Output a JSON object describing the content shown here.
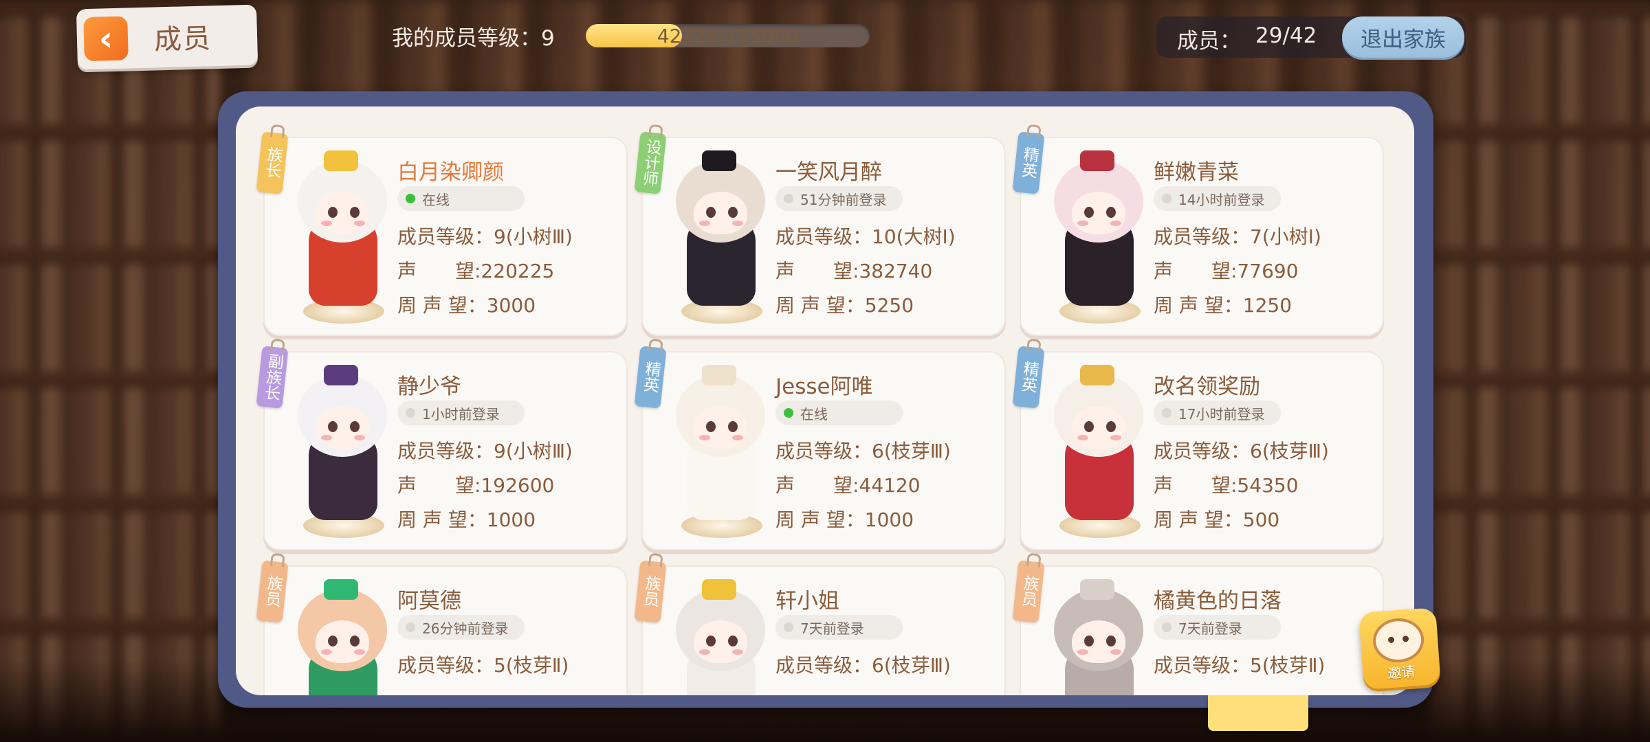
{
  "header": {
    "back_title": "成员",
    "my_level_text": "我的成员等级：9",
    "exp_text": "42225/125000",
    "exp_fraction": 0.338,
    "member_label": "成员：",
    "member_count": "29/42",
    "leave_button": "退出家族"
  },
  "members": [
    {
      "tag": "族长",
      "tag_color": "#f4c35a",
      "name": "白月染卿颜",
      "name_color": "#e6783a",
      "status": "在线",
      "online": true,
      "level": "成员等级：9(小树Ⅲ)",
      "prestige": "声　　望:220225",
      "weekly": "周 声 望：3000",
      "hair": "#f4f1ee",
      "outfit": "#d8402e",
      "accent": "#f2c23c"
    },
    {
      "tag": "设计师",
      "tag_color": "#8ccf74",
      "name": "一笑风月醉",
      "name_color": "#8a5c3c",
      "status": "51分钟前登录",
      "online": false,
      "level": "成员等级：10(大树Ⅰ)",
      "prestige": "声　　望:382740",
      "weekly": "周 声 望：5250",
      "hair": "#e9ddd2",
      "outfit": "#2b2530",
      "accent": "#1e1a1f"
    },
    {
      "tag": "精英",
      "tag_color": "#7fb0d9",
      "name": "鲜嫩青菜",
      "name_color": "#8a5c3c",
      "status": "14小时前登录",
      "online": false,
      "level": "成员等级：7(小树Ⅰ)",
      "prestige": "声　　望:77690",
      "weekly": "周 声 望：1250",
      "hair": "#f6dde3",
      "outfit": "#2a2228",
      "accent": "#b8323f"
    },
    {
      "tag": "副族长",
      "tag_color": "#b89ae0",
      "name": "静少爷",
      "name_color": "#8a5c3c",
      "status": "1小时前登录",
      "online": false,
      "level": "成员等级：9(小树Ⅲ)",
      "prestige": "声　　望:192600",
      "weekly": "周 声 望：1000",
      "hair": "#f3f1f4",
      "outfit": "#3a2c3c",
      "accent": "#5b3d7e"
    },
    {
      "tag": "精英",
      "tag_color": "#7fb0d9",
      "name": "Jesse阿唯",
      "name_color": "#8a5c3c",
      "status": "在线",
      "online": true,
      "level": "成员等级：6(枝芽Ⅲ)",
      "prestige": "声　　望:44120",
      "weekly": "周 声 望：1000",
      "hair": "#f7f0e6",
      "outfit": "#faf6f0",
      "accent": "#efe1cc"
    },
    {
      "tag": "精英",
      "tag_color": "#7fb0d9",
      "name": "改名领奖励",
      "name_color": "#8a5c3c",
      "status": "17小时前登录",
      "online": false,
      "level": "成员等级：6(枝芽Ⅲ)",
      "prestige": "声　　望:54350",
      "weekly": "周 声 望：500",
      "hair": "#f6efe8",
      "outfit": "#c8303a",
      "accent": "#e8b84a"
    },
    {
      "tag": "族员",
      "tag_color": "#f2b88a",
      "name": "阿莫德",
      "name_color": "#8a5c3c",
      "status": "26分钟前登录",
      "online": false,
      "level": "成员等级：5(枝芽Ⅱ)",
      "prestige": "",
      "weekly": "",
      "hair": "#f4c7a6",
      "outfit": "#2e9b62",
      "accent": "#2eb872"
    },
    {
      "tag": "族员",
      "tag_color": "#f2b88a",
      "name": "轩小姐",
      "name_color": "#8a5c3c",
      "status": "7天前登录",
      "online": false,
      "level": "成员等级：6(枝芽Ⅲ)",
      "prestige": "",
      "weekly": "",
      "hair": "#ece6e2",
      "outfit": "#f2ece8",
      "accent": "#f0c23a"
    },
    {
      "tag": "族员",
      "tag_color": "#f2b88a",
      "name": "橘黄色的日落",
      "name_color": "#8a5c3c",
      "status": "7天前登录",
      "online": false,
      "level": "成员等级：5(枝芽Ⅱ)",
      "prestige": "",
      "weekly": "",
      "hair": "#c7bcb8",
      "outfit": "#b8aca8",
      "accent": "#d8cfcb"
    }
  ],
  "colors": {
    "online_dot": "#3cbf3c",
    "offline_dot": "#dcd6d0",
    "panel_frame": "#515a86"
  },
  "invite": {
    "label": "邀请",
    "icon": "bear-face-icon"
  }
}
